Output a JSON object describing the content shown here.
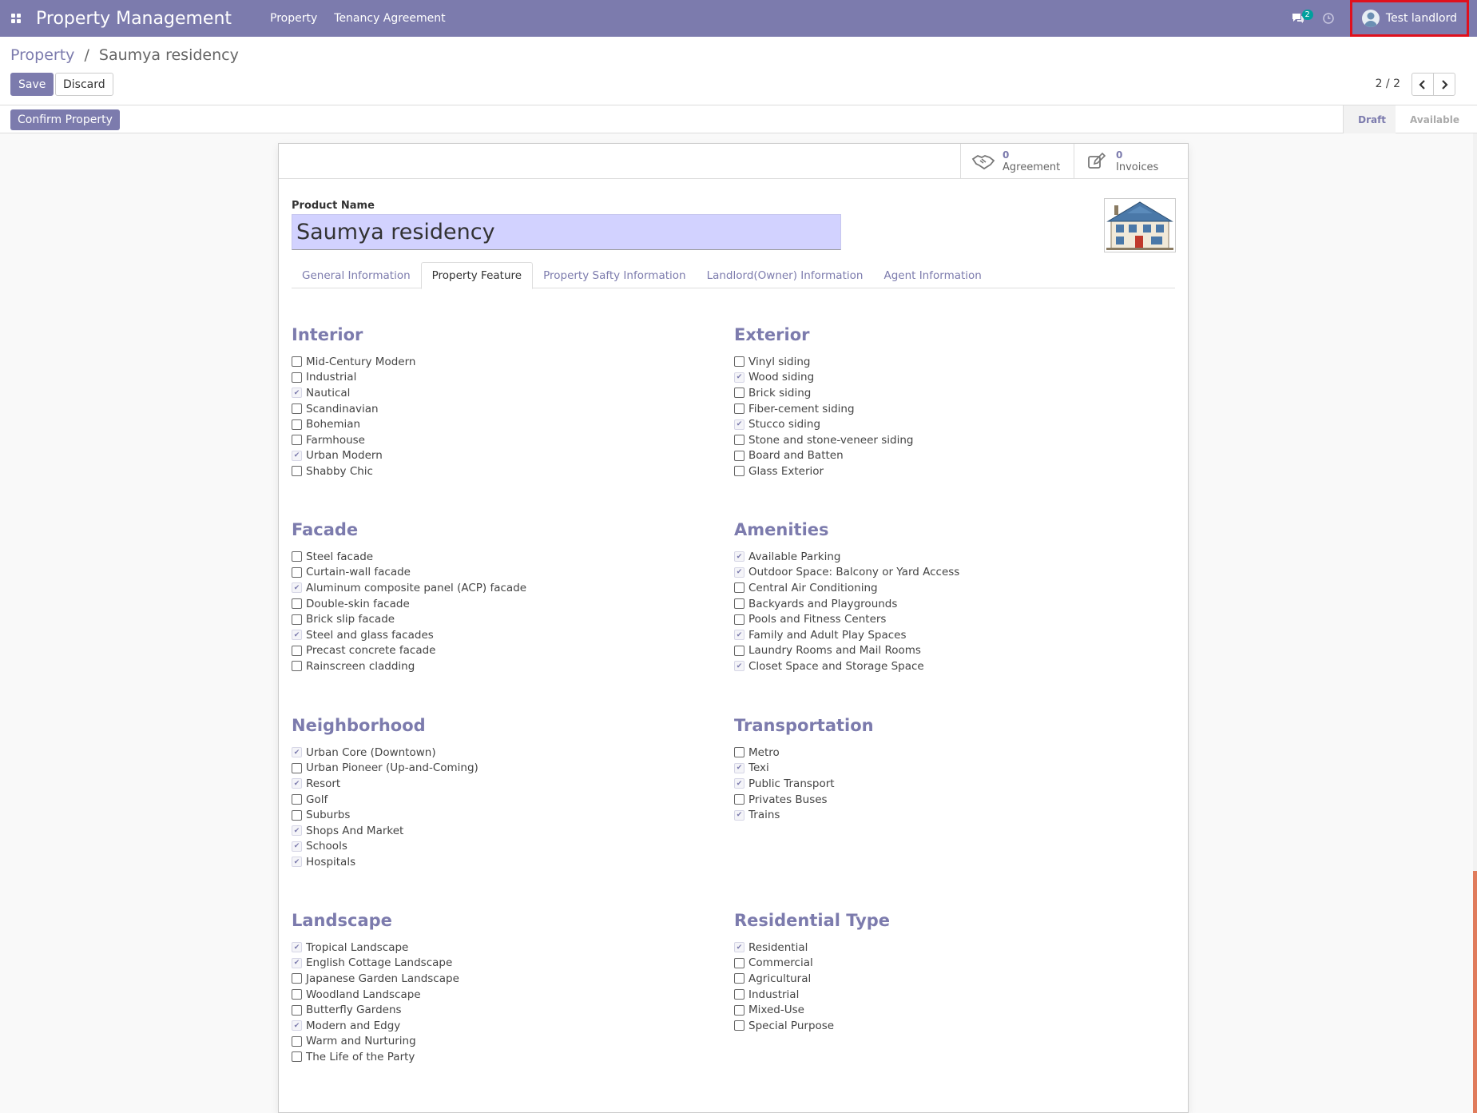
{
  "navbar": {
    "brand": "Property Management",
    "menus": [
      "Property",
      "Tenancy Agreement"
    ],
    "chat_count": "2",
    "user_name": "Test landlord"
  },
  "breadcrumb": {
    "parent": "Property",
    "separator": "/",
    "current": "Saumya residency"
  },
  "actions": {
    "save": "Save",
    "discard": "Discard"
  },
  "pager": {
    "value": "2 / 2"
  },
  "header": {
    "confirm": "Confirm Property",
    "stages": [
      "Draft",
      "Available"
    ],
    "active_stage": "Draft"
  },
  "smart_buttons": {
    "agreement": {
      "count": "0",
      "label": "Agreement"
    },
    "invoices": {
      "count": "0",
      "label": "Invoices"
    }
  },
  "form": {
    "product_name_label": "Product Name",
    "product_name": "Saumya residency"
  },
  "tabs": [
    "General Information",
    "Property Feature",
    "Property Safty Information",
    "Landlord(Owner) Information",
    "Agent Information"
  ],
  "active_tab": "Property Feature",
  "groups": {
    "interior": {
      "title": "Interior",
      "items": [
        {
          "label": "Mid-Century Modern",
          "checked": false
        },
        {
          "label": "Industrial",
          "checked": false
        },
        {
          "label": "Nautical",
          "checked": true
        },
        {
          "label": "Scandinavian",
          "checked": false
        },
        {
          "label": "Bohemian",
          "checked": false
        },
        {
          "label": "Farmhouse",
          "checked": false
        },
        {
          "label": "Urban Modern",
          "checked": true
        },
        {
          "label": "Shabby Chic",
          "checked": false
        }
      ]
    },
    "exterior": {
      "title": "Exterior",
      "items": [
        {
          "label": "Vinyl siding",
          "checked": false
        },
        {
          "label": "Wood siding",
          "checked": true
        },
        {
          "label": "Brick siding",
          "checked": false
        },
        {
          "label": "Fiber-cement siding",
          "checked": false
        },
        {
          "label": "Stucco siding",
          "checked": true
        },
        {
          "label": "Stone and stone-veneer siding",
          "checked": false
        },
        {
          "label": "Board and Batten",
          "checked": false
        },
        {
          "label": "Glass Exterior",
          "checked": false
        }
      ]
    },
    "facade": {
      "title": "Facade",
      "items": [
        {
          "label": "Steel facade",
          "checked": false
        },
        {
          "label": "Curtain-wall facade",
          "checked": false
        },
        {
          "label": "Aluminum composite panel (ACP) facade",
          "checked": true
        },
        {
          "label": "Double-skin facade",
          "checked": false
        },
        {
          "label": "Brick slip facade",
          "checked": false
        },
        {
          "label": "Steel and glass facades",
          "checked": true
        },
        {
          "label": "Precast concrete facade",
          "checked": false
        },
        {
          "label": "Rainscreen cladding",
          "checked": false
        }
      ]
    },
    "amenities": {
      "title": "Amenities",
      "items": [
        {
          "label": "Available Parking",
          "checked": true
        },
        {
          "label": "Outdoor Space: Balcony or Yard Access",
          "checked": true
        },
        {
          "label": "Central Air Conditioning",
          "checked": false
        },
        {
          "label": "Backyards and Playgrounds",
          "checked": false
        },
        {
          "label": "Pools and Fitness Centers",
          "checked": false
        },
        {
          "label": "Family and Adult Play Spaces",
          "checked": true
        },
        {
          "label": "Laundry Rooms and Mail Rooms",
          "checked": false
        },
        {
          "label": "Closet Space and Storage Space",
          "checked": true
        }
      ]
    },
    "neighborhood": {
      "title": "Neighborhood",
      "items": [
        {
          "label": "Urban Core (Downtown)",
          "checked": true
        },
        {
          "label": "Urban Pioneer (Up-and-Coming)",
          "checked": false
        },
        {
          "label": "Resort",
          "checked": true
        },
        {
          "label": "Golf",
          "checked": false
        },
        {
          "label": "Suburbs",
          "checked": false
        },
        {
          "label": "Shops And Market",
          "checked": true
        },
        {
          "label": "Schools",
          "checked": true
        },
        {
          "label": "Hospitals",
          "checked": true
        }
      ]
    },
    "transportation": {
      "title": "Transportation",
      "items": [
        {
          "label": "Metro",
          "checked": false
        },
        {
          "label": "Texi",
          "checked": true
        },
        {
          "label": "Public Transport",
          "checked": true
        },
        {
          "label": "Privates Buses",
          "checked": false
        },
        {
          "label": "Trains",
          "checked": true
        }
      ]
    },
    "landscape": {
      "title": "Landscape",
      "items": [
        {
          "label": "Tropical Landscape",
          "checked": true
        },
        {
          "label": "English Cottage Landscape",
          "checked": true
        },
        {
          "label": "Japanese Garden Landscape",
          "checked": false
        },
        {
          "label": "Woodland Landscape",
          "checked": false
        },
        {
          "label": "Butterfly Gardens",
          "checked": false
        },
        {
          "label": "Modern and Edgy",
          "checked": true
        },
        {
          "label": "Warm and Nurturing",
          "checked": false
        },
        {
          "label": "The Life of the Party",
          "checked": false
        }
      ]
    },
    "residential_type": {
      "title": "Residential Type",
      "items": [
        {
          "label": "Residential",
          "checked": true
        },
        {
          "label": "Commercial",
          "checked": false
        },
        {
          "label": "Agricultural",
          "checked": false
        },
        {
          "label": "Industrial",
          "checked": false
        },
        {
          "label": "Mixed-Use",
          "checked": false
        },
        {
          "label": "Special Purpose",
          "checked": false
        }
      ]
    }
  },
  "colors": {
    "brand": "#7c7bad",
    "name_field_bg": "#d2d2ff",
    "highlight_border": "#e0101d",
    "badge": "#00a09d"
  },
  "icons": {
    "apps": "apps-grid-icon",
    "chat": "chat-icon",
    "clock": "clock-icon",
    "agreement": "handshake-icon",
    "invoices": "edit-icon"
  }
}
